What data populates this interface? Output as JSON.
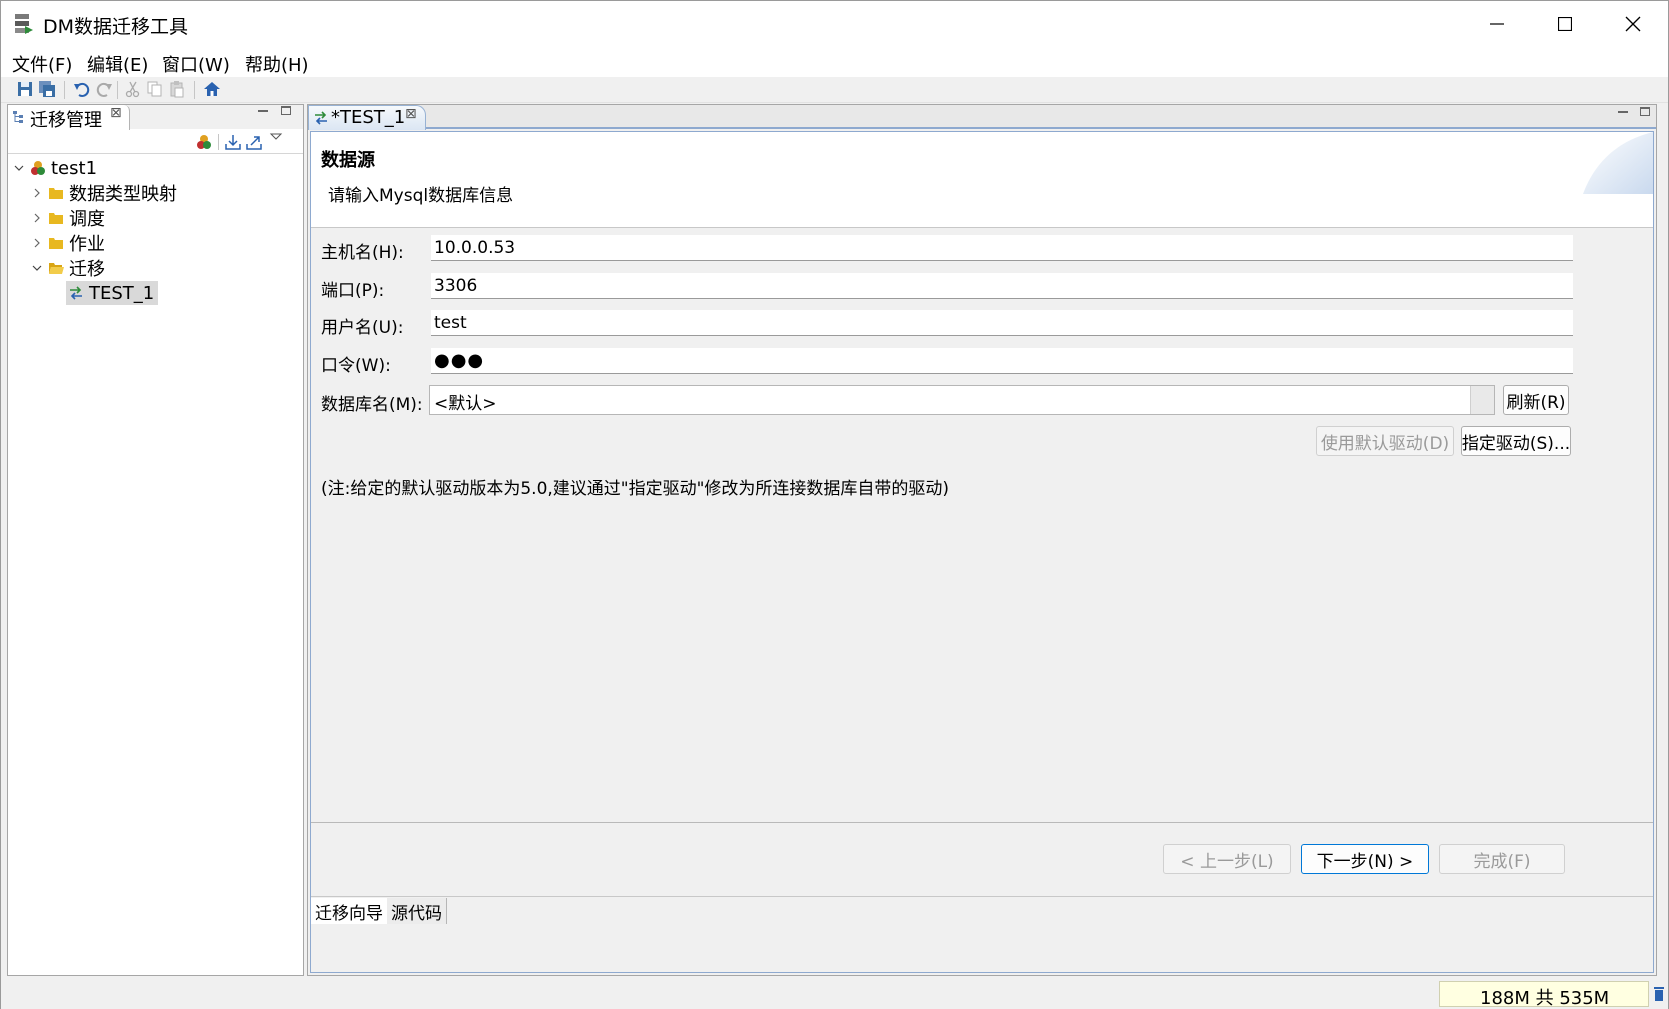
{
  "window": {
    "title": "DM数据迁移工具"
  },
  "menubar": [
    "文件(F)",
    "编辑(E)",
    "窗口(W)",
    "帮助(H)"
  ],
  "toolbar": {
    "icons": [
      "save-icon",
      "save-all-icon",
      "undo-icon",
      "redo-icon",
      "cut-icon",
      "copy-icon",
      "paste-icon",
      "home-icon"
    ]
  },
  "left_panel": {
    "tab_label": "迁移管理",
    "tree": {
      "root": "test1",
      "children": [
        "数据类型映射",
        "调度",
        "作业",
        "迁移"
      ],
      "migration_item": "TEST_1"
    }
  },
  "editor": {
    "tab_label": "*TEST_1",
    "wizard": {
      "title": "数据源",
      "description": "请输入Mysql数据库信息",
      "fields": {
        "host_label": "主机名(H):",
        "host_value": "10.0.0.53",
        "port_label": "端口(P):",
        "port_value": "3306",
        "user_label": "用户名(U):",
        "user_value": "test",
        "password_label": "口令(W):",
        "password_dots": "●●●",
        "db_label": "数据库名(M):",
        "db_value": "<默认>"
      },
      "buttons": {
        "refresh": "刷新(R)",
        "use_default_driver": "使用默认驱动(D)",
        "specify_driver": "指定驱动(S)...",
        "prev": "< 上一步(L)",
        "next": "下一步(N) >",
        "finish": "完成(F)"
      },
      "note": "(注:给定的默认驱动版本为5.0,建议通过\"指定驱动\"修改为所连接数据库自带的驱动)"
    },
    "bottom_tabs": [
      "迁移向导",
      "源代码"
    ]
  },
  "statusbar": {
    "heap": "188M 共 535M"
  }
}
